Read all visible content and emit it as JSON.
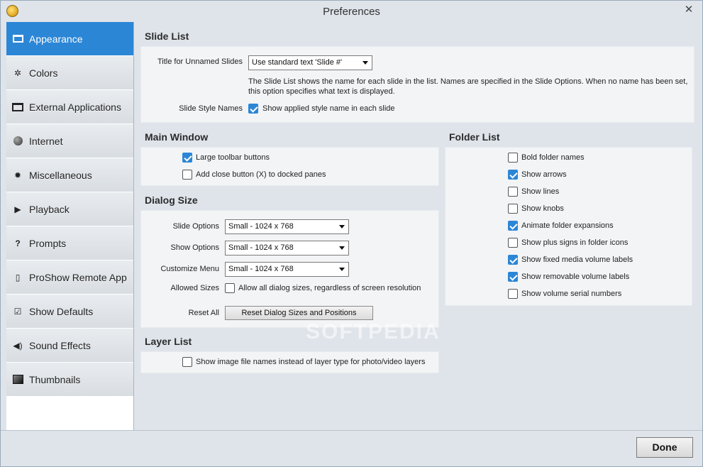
{
  "window": {
    "title": "Preferences",
    "close_glyph": "✕"
  },
  "sidebar": {
    "items": [
      {
        "label": "Appearance",
        "icon": "appearance-icon",
        "active": true
      },
      {
        "label": "Colors",
        "icon": "colors-icon"
      },
      {
        "label": "External Applications",
        "icon": "external-applications-icon"
      },
      {
        "label": "Internet",
        "icon": "internet-globe-icon"
      },
      {
        "label": "Miscellaneous",
        "icon": "gear-icon"
      },
      {
        "label": "Playback",
        "icon": "play-icon"
      },
      {
        "label": "Prompts",
        "icon": "question-icon"
      },
      {
        "label": "ProShow Remote App",
        "icon": "remote-app-icon"
      },
      {
        "label": "Show Defaults",
        "icon": "show-defaults-icon"
      },
      {
        "label": "Sound Effects",
        "icon": "speaker-icon"
      },
      {
        "label": "Thumbnails",
        "icon": "thumbnails-icon"
      }
    ]
  },
  "slide_list": {
    "title": "Slide List",
    "unnamed_label": "Title for Unnamed Slides",
    "unnamed_value": "Use standard text 'Slide #'",
    "description": "The Slide List shows the name for each slide in the list. Names are specified in the Slide Options. When no name has been set, this option specifies what text is displayed.",
    "style_names_label": "Slide Style Names",
    "style_names_checkbox": "Show applied style name in each slide",
    "style_names_checked": true
  },
  "main_window": {
    "title": "Main Window",
    "large_toolbar": "Large toolbar buttons",
    "large_toolbar_checked": true,
    "close_button": "Add close button (X) to docked panes",
    "close_button_checked": false
  },
  "dialog_size": {
    "title": "Dialog Size",
    "slide_options_label": "Slide Options",
    "slide_options_value": "Small - 1024 x 768",
    "show_options_label": "Show Options",
    "show_options_value": "Small - 1024 x 768",
    "customize_menu_label": "Customize Menu",
    "customize_menu_value": "Small - 1024 x 768",
    "allowed_sizes_label": "Allowed Sizes",
    "allowed_sizes_checkbox": "Allow all dialog sizes, regardless of screen resolution",
    "allowed_sizes_checked": false,
    "reset_all_label": "Reset All",
    "reset_button": "Reset Dialog Sizes and Positions"
  },
  "layer_list": {
    "title": "Layer List",
    "checkbox": "Show image file names instead of layer type for photo/video layers",
    "checked": false
  },
  "folder_list": {
    "title": "Folder List",
    "options": [
      {
        "label": "Bold folder names",
        "checked": false
      },
      {
        "label": "Show arrows",
        "checked": true
      },
      {
        "label": "Show lines",
        "checked": false
      },
      {
        "label": "Show knobs",
        "checked": false
      },
      {
        "label": "Animate folder expansions",
        "checked": true
      },
      {
        "label": "Show plus signs in folder icons",
        "checked": false
      },
      {
        "label": "Show fixed media volume labels",
        "checked": true
      },
      {
        "label": "Show removable volume labels",
        "checked": true
      },
      {
        "label": "Show volume serial numbers",
        "checked": false
      }
    ]
  },
  "footer": {
    "done_label": "Done"
  },
  "watermark": "SOFTPEDIA",
  "colors": {
    "accent": "#2c86d6",
    "background": "#dfe4ea",
    "panel": "#f2f4f6"
  }
}
